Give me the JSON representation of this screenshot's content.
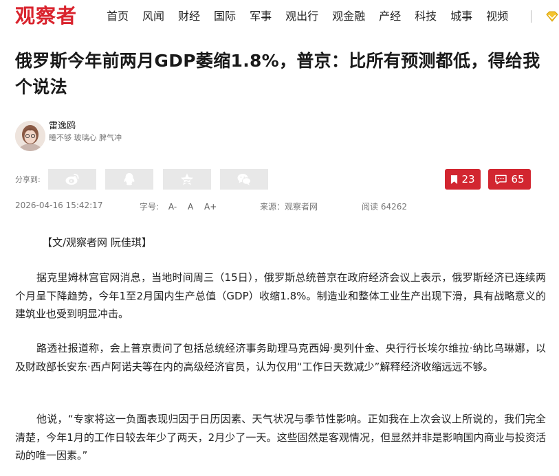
{
  "site": {
    "logo": "观察者",
    "nav": [
      "首页",
      "风闻",
      "财经",
      "国际",
      "军事",
      "观出行",
      "观金融",
      "产经",
      "科技",
      "城事",
      "视频"
    ]
  },
  "article": {
    "title": "俄罗斯今年前两月GDP萎缩1.8%，普京：比所有预测都低，得给我个说法",
    "author": {
      "name": "雷逸鸥",
      "tagline": "睡不够 玻璃心 脾气冲"
    },
    "share": {
      "label": "分享到:",
      "icons": [
        "weibo-icon",
        "qq-icon",
        "qzone-icon",
        "wechat-icon"
      ]
    },
    "bookmark_count": "23",
    "comment_count": "65",
    "meta": {
      "datetime": "2026-04-16 15:42:17",
      "font_label": "字号:",
      "font_small": "A-",
      "font_normal": "A",
      "font_large": "A+",
      "source": "来源：观察者网",
      "reads": "阅读 64262"
    },
    "byline": "【文/观察者网 阮佳琪】",
    "paragraphs": [
      "据克里姆林宫官网消息，当地时间周三（15日），俄罗斯总统普京在政府经济会议上表示，俄罗斯经济已连续两个月呈下降趋势，今年1至2月国内生产总值（GDP）收缩1.8%。制造业和整体工业生产出现下滑，具有战略意义的建筑业也受到明显冲击。",
      "路透社报道称，会上普京责问了包括总统经济事务助理马克西姆·奥列什金、央行行长埃尔维拉·纳比乌琳娜，以及财政部长安东·西卢阿诺夫等在内的高级经济官员，认为仅用“工作日天数减少”解释经济收缩远远不够。",
      "他说，“专家将这一负面表现归因于日历因素、天气状况与季节性影响。正如我在上次会议上所说的，我们完全清楚，今年1月的工作日较去年少了两天，2月少了一天。这些固然是客观情况，但显然并非是影响国内商业与投资活动的唯一因素。”"
    ]
  },
  "colors": {
    "brand_red": "#d9232d",
    "button_red": "#d22630",
    "share_gray": "#e8e8e8"
  }
}
